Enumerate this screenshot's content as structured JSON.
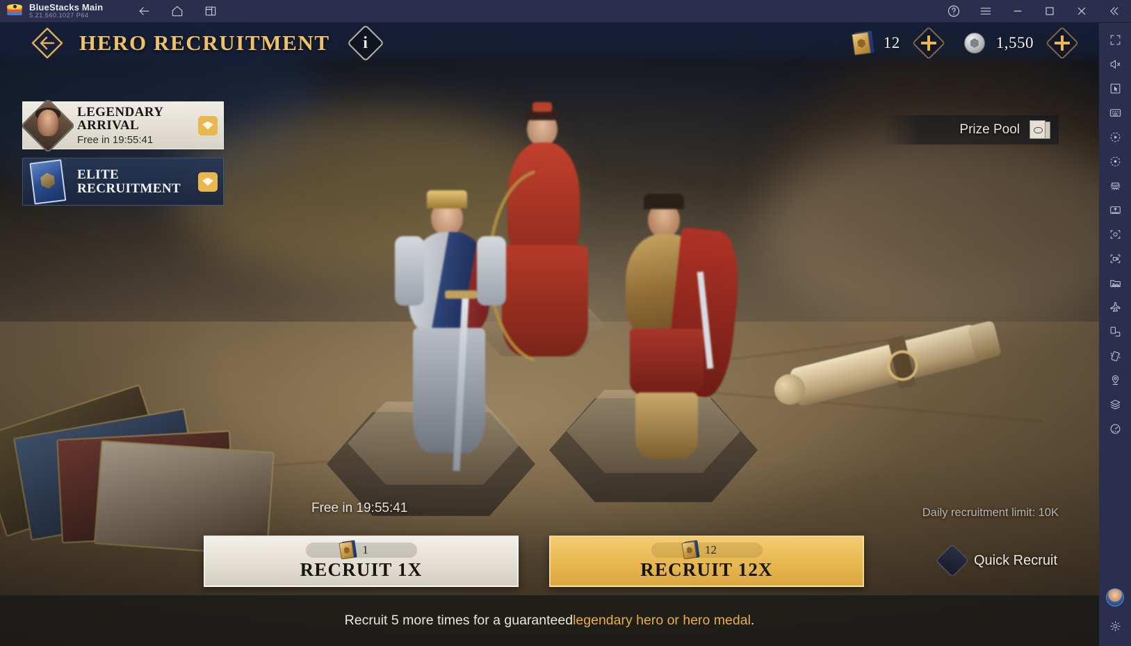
{
  "titlebar": {
    "app_name": "BlueStacks Main",
    "version": "5.21.560.1027  P64",
    "logo_icon": "bluestacks-logo",
    "nav": [
      {
        "icon": "back-arrow-icon",
        "name": "back-button"
      },
      {
        "icon": "home-icon",
        "name": "home-button"
      },
      {
        "icon": "instances-icon",
        "name": "instance-manager-button"
      }
    ],
    "window_controls": [
      {
        "icon": "help-circle-icon",
        "name": "help-button"
      },
      {
        "icon": "hamburger-menu-icon",
        "name": "menu-button"
      },
      {
        "icon": "minimize-icon",
        "name": "minimize-button"
      },
      {
        "icon": "maximize-icon",
        "name": "maximize-button"
      },
      {
        "icon": "close-icon",
        "name": "close-button"
      },
      {
        "icon": "collapse-sidebar-icon",
        "name": "collapse-sidebar-button"
      }
    ]
  },
  "sidebar": {
    "items": [
      {
        "icon": "fullscreen-icon",
        "name": "fullscreen-button"
      },
      {
        "icon": "mute-icon",
        "name": "mute-button"
      },
      {
        "icon": "cursor-icon",
        "name": "cursor-mode-button"
      },
      {
        "icon": "keyboard-icon",
        "name": "game-controls-button"
      },
      {
        "icon": "macro-play-icon",
        "name": "macro-recorder-button"
      },
      {
        "icon": "record-icon",
        "name": "script-button"
      },
      {
        "icon": "multi-instance-icon",
        "name": "multi-instance-button"
      },
      {
        "icon": "apk-install-icon",
        "name": "install-apk-button"
      },
      {
        "icon": "screenshot-icon",
        "name": "screenshot-button"
      },
      {
        "icon": "video-record-icon",
        "name": "record-video-button"
      },
      {
        "icon": "media-folder-icon",
        "name": "media-manager-button"
      },
      {
        "icon": "airplane-icon",
        "name": "airplane-mode-button"
      },
      {
        "icon": "rotate-screen-icon",
        "name": "rotate-button"
      },
      {
        "icon": "shake-icon",
        "name": "shake-button"
      },
      {
        "icon": "location-pin-icon",
        "name": "location-button"
      },
      {
        "icon": "layers-icon",
        "name": "eco-mode-button"
      },
      {
        "icon": "speedometer-icon",
        "name": "performance-button"
      }
    ],
    "avatar": {
      "icon": "user-avatar",
      "name": "account-avatar"
    },
    "settings": {
      "icon": "gear-icon",
      "name": "settings-button"
    }
  },
  "header": {
    "back_icon": "back-arrow-diamond-icon",
    "title": "HERO RECRUITMENT",
    "info_icon": "info-icon",
    "info_glyph": "i",
    "currencies": [
      {
        "icon": "recruitment-tome-icon",
        "name": "recruit-ticket-currency",
        "value": "12",
        "plus_icon": "plus-icon"
      },
      {
        "icon": "silver-coin-icon",
        "name": "silver-currency",
        "value": "1,550",
        "plus_icon": "plus-icon"
      }
    ]
  },
  "banners": [
    {
      "name": "legendary-arrival",
      "icon": "hero-portrait-icon",
      "line1": "LEGENDARY",
      "line2": "ARRIVAL",
      "sub": "Free in 19:55:41",
      "badge_icon": "gem-icon",
      "active": true
    },
    {
      "name": "elite-recruitment",
      "icon": "elite-card-icon",
      "line1": "ELITE",
      "line2": "RECRUITMENT",
      "sub": "",
      "badge_icon": "gem-icon",
      "active": false
    }
  ],
  "prize_pool": {
    "label": "Prize Pool",
    "icon": "prize-cards-icon"
  },
  "bottom": {
    "free_in": "Free in 19:55:41",
    "daily_limit": "Daily recruitment limit: 10K",
    "buttons": [
      {
        "name": "recruit-1x",
        "cost_icon": "recruitment-tome-icon",
        "cost": "1",
        "label": "RECRUIT 1X",
        "style": "light"
      },
      {
        "name": "recruit-12x",
        "cost_icon": "recruitment-tome-icon",
        "cost": "12",
        "label": "RECRUIT 12X",
        "style": "gold"
      }
    ],
    "quick_recruit": {
      "label": "Quick Recruit",
      "checkbox_icon": "diamond-checkbox-icon",
      "checked": false
    },
    "hint_prefix": "Recruit 5 more times for a guaranteed ",
    "hint_highlight": "legendary hero or hero medal",
    "hint_suffix": "."
  },
  "colors": {
    "gold": "#efc169",
    "gold_button": "#e8b851",
    "header_blue": "#16203a",
    "bluestacks_bar": "#2b2e4d",
    "hint_highlight": "#e9ae45"
  }
}
